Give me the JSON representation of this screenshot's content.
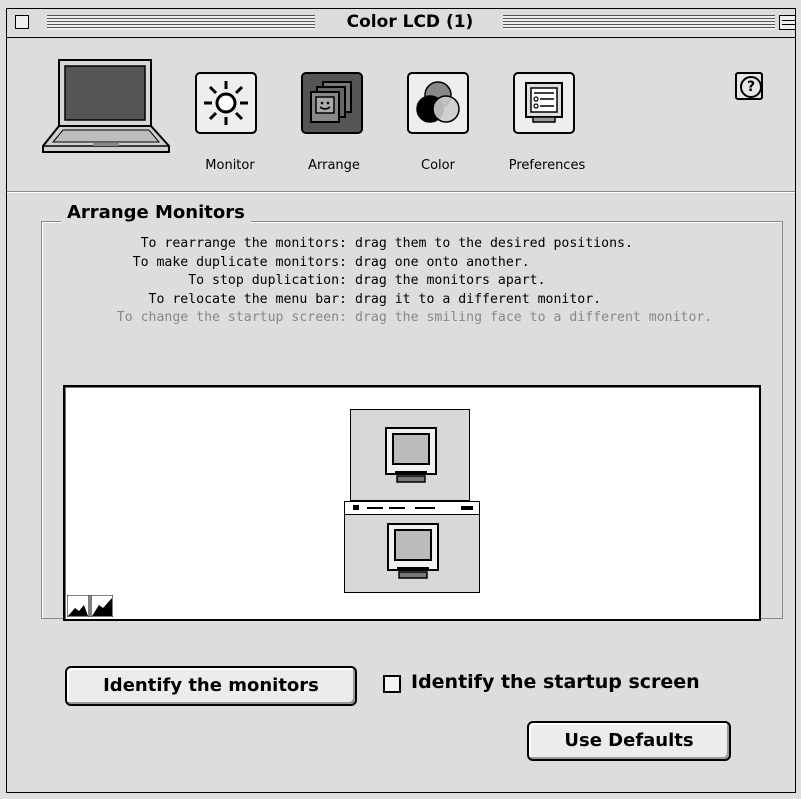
{
  "window": {
    "title": "Color LCD (1)"
  },
  "panes": [
    {
      "label": "Monitor",
      "icon": "sun-icon"
    },
    {
      "label": "Arrange",
      "icon": "arrange-monitors-icon",
      "selected": true
    },
    {
      "label": "Color",
      "icon": "color-circles-icon"
    },
    {
      "label": "Preferences",
      "icon": "preferences-monitor-icon"
    }
  ],
  "help": {
    "glyph": "?"
  },
  "group": {
    "title": "Arrange Monitors"
  },
  "instructions": [
    {
      "key": "To rearrange the monitors:",
      "value": "drag them to the desired positions.",
      "enabled": true
    },
    {
      "key": "To make duplicate monitors:",
      "value": "drag one onto another.",
      "enabled": true
    },
    {
      "key": "To stop duplication:",
      "value": "drag the monitors apart.",
      "enabled": true
    },
    {
      "key": "To relocate the menu bar:",
      "value": "drag it to a different monitor.",
      "enabled": true
    },
    {
      "key": "To change the startup screen:",
      "value": "drag the smiling face to a different monitor.",
      "enabled": false
    }
  ],
  "buttons": {
    "identify": "Identify the monitors",
    "defaults": "Use Defaults"
  },
  "checkbox": {
    "label": "Identify the startup screen",
    "checked": false
  }
}
